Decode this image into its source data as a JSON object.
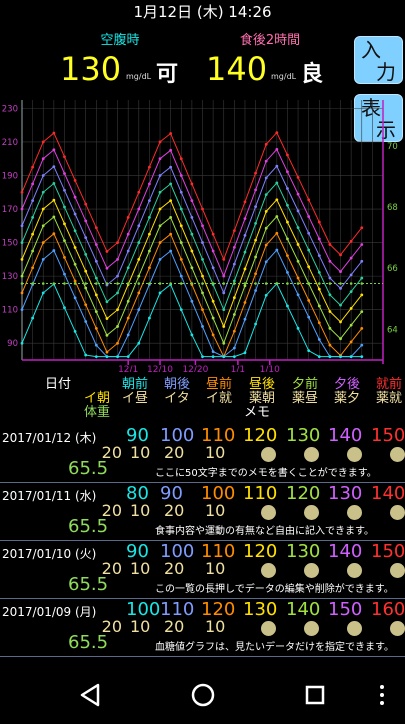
{
  "status": {
    "datetime": "1月12日 (木)  14:26"
  },
  "top": {
    "fasting_label": "空腹時",
    "postmeal_label": "食後2時間",
    "fasting_value": "130",
    "postmeal_value": "140",
    "unit": "mg/dL",
    "fasting_judge": "可",
    "postmeal_judge": "良"
  },
  "buttons": {
    "input": [
      "入",
      "力"
    ],
    "display": [
      "表",
      "示"
    ]
  },
  "chart_data": {
    "type": "line",
    "x_tick_labels": [
      "12/1",
      "12/10",
      "12/20",
      "1/1",
      "1/10"
    ],
    "y_left_ticks": [
      "230",
      "210",
      "190",
      "170",
      "150",
      "130",
      "110",
      "90"
    ],
    "y_right_ticks": [
      "70",
      "68",
      "66",
      "64"
    ],
    "ylim_left": [
      80,
      235
    ],
    "ylim_right": [
      63,
      71.5
    ],
    "grid": true,
    "series_colors": [
      "#ff2a2a",
      "#e040e0",
      "#8080ff",
      "#2ad0a0",
      "#ffe000",
      "#a0e040",
      "#ff8c00",
      "#50a0ff",
      "#19e6e6"
    ],
    "series_offsets": [
      60,
      50,
      40,
      30,
      20,
      10,
      0,
      -10,
      -30
    ],
    "peak_base": 160,
    "trough_base": 80,
    "peak_days": [
      8,
      41,
      71
    ],
    "trough_days": [
      25,
      57,
      89
    ],
    "weight_line": 65.5,
    "weight_color": "#7ad040"
  },
  "table": {
    "header": {
      "date": "日付",
      "col1": [
        "朝前",
        "イ朝",
        "体重"
      ],
      "col2": [
        "朝後",
        "イ昼"
      ],
      "col3": [
        "昼前",
        "イタ"
      ],
      "col4": [
        "昼後",
        "イ就"
      ],
      "col5": [
        "夕前",
        "薬朝"
      ],
      "col6": [
        "夕後",
        "薬昼"
      ],
      "col7": [
        "就前",
        "薬夕"
      ],
      "col8": [
        "",
        "薬就"
      ],
      "memo": "メモ"
    },
    "rows": [
      {
        "date": "2017/01/12 (木)",
        "values": [
          "90",
          "100",
          "110",
          "120",
          "130",
          "140",
          "150"
        ],
        "insulin": [
          "20",
          "10",
          "20",
          "10"
        ],
        "weight": "65.5",
        "memo": "ここに50文字までのメモを書くことができます。"
      },
      {
        "date": "2017/01/11 (水)",
        "values": [
          "80",
          "90",
          "100",
          "110",
          "120",
          "130",
          "140"
        ],
        "insulin": [
          "20",
          "10",
          "20",
          "10"
        ],
        "weight": "65.5",
        "memo": "食事内容や運動の有無など自由に記入できます。"
      },
      {
        "date": "2017/01/10 (火)",
        "values": [
          "90",
          "100",
          "110",
          "120",
          "130",
          "140",
          "150"
        ],
        "insulin": [
          "20",
          "10",
          "20",
          "10"
        ],
        "weight": "65.5",
        "memo": "この一覧の長押しでデータの編集や削除ができます。"
      },
      {
        "date": "2017/01/09 (月)",
        "values": [
          "100",
          "110",
          "120",
          "130",
          "140",
          "150",
          "160"
        ],
        "insulin": [
          "20",
          "10",
          "20",
          "10"
        ],
        "weight": "65.5",
        "memo": "血糖値グラフは、見たいデータだけを指定できます。"
      }
    ]
  },
  "colors": {
    "c1": "#19e6e6",
    "c2": "#7f9cff",
    "c3": "#ff8c00",
    "c4": "#ffe000",
    "c5": "#a0e040",
    "c6": "#d060ff",
    "c7": "#ff3030",
    "insulin": "#f0e0a0"
  },
  "nav": {
    "back": "back-icon",
    "home": "home-icon",
    "recents": "recents-icon",
    "more": "more-icon"
  }
}
